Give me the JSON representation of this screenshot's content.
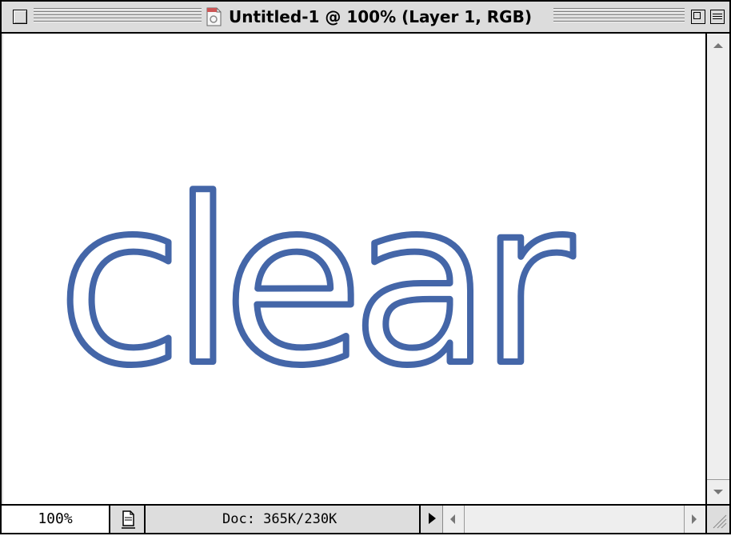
{
  "window": {
    "title": "Untitled-1 @ 100% (Layer 1, RGB)"
  },
  "canvas": {
    "text": "clear",
    "stroke_color": "#4466a8",
    "fill_color": "#ffffff"
  },
  "statusbar": {
    "zoom": "100%",
    "doc_info": "Doc: 365K/230K"
  },
  "icons": {
    "close": "close-box-icon",
    "document": "document-icon",
    "zoom": "zoom-box-icon",
    "collapse": "collapse-box-icon",
    "preview": "preview-page-icon",
    "info_menu": "triangle-right-icon"
  }
}
